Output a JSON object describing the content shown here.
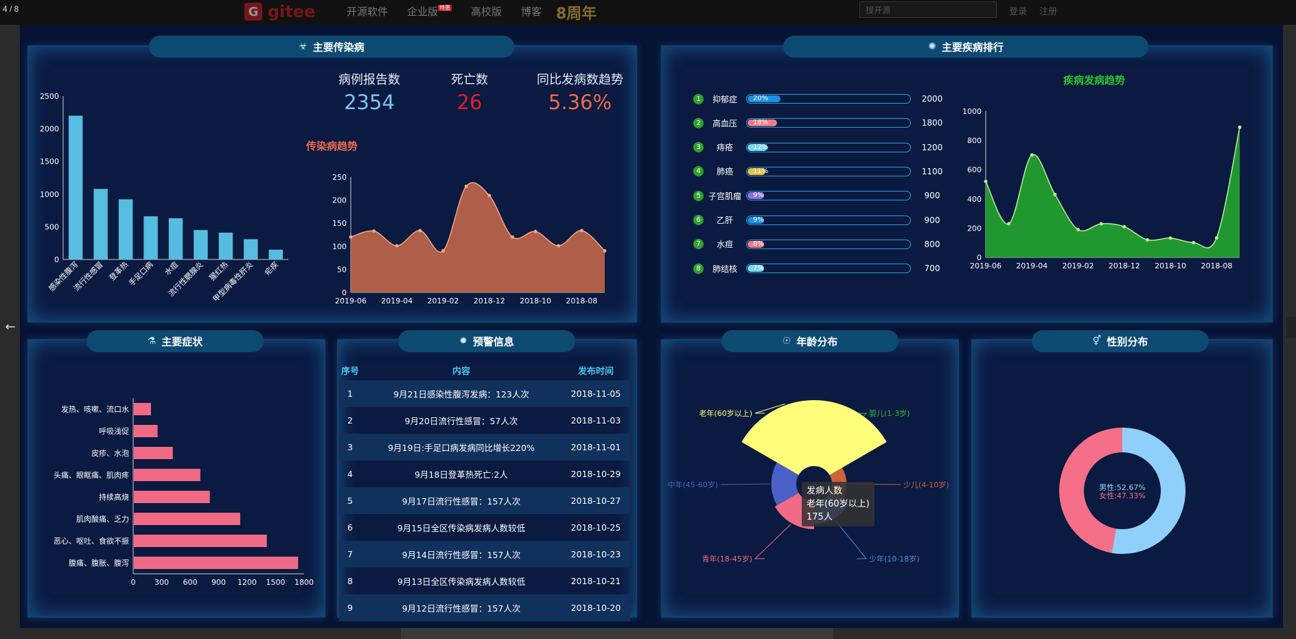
{
  "viewer": {
    "counter": "4 / 8",
    "prev_arrow": "←"
  },
  "browser_bg": {
    "brand": "gitee",
    "nav": [
      "开源软件",
      "企业版",
      "高校版",
      "博客"
    ],
    "badge": "特惠",
    "anniv": "8周年",
    "search_placeholder": "搜开源",
    "links": [
      "登录",
      "注册"
    ]
  },
  "infectious": {
    "title": "主要传染病",
    "stats": [
      {
        "label": "病例报告数",
        "value": "2354",
        "color": "#7cc4f6"
      },
      {
        "label": "死亡数",
        "value": "26",
        "color": "#e0202a"
      },
      {
        "label": "同比发病数趋势",
        "value": "5.36%",
        "color": "#ee6a4b"
      }
    ],
    "bar_chart": {
      "type": "bar",
      "categories": [
        "感染性腹泻",
        "流行性感冒",
        "登革热",
        "手足口病",
        "水痘",
        "流行性腮腺炎",
        "猩红热",
        "甲型病毒性肝炎",
        "疟疾"
      ],
      "values": [
        2200,
        1080,
        920,
        660,
        630,
        450,
        410,
        310,
        150
      ],
      "yticks": [
        "0",
        "500",
        "1000",
        "1500",
        "2000",
        "2500"
      ],
      "ylim": [
        0,
        2500
      ],
      "color": "#56bde0"
    },
    "trend_title": "传染病趋势",
    "trend_chart": {
      "type": "area",
      "values": [
        120,
        133,
        101,
        134,
        90,
        230,
        210,
        120,
        132,
        101,
        134,
        90
      ],
      "xticks": [
        "2019-06",
        "2019-04",
        "2019-02",
        "2018-12",
        "2018-10",
        "2018-08"
      ],
      "yticks": [
        "0",
        "50",
        "100",
        "150",
        "200",
        "250"
      ],
      "ylim": [
        0,
        250
      ],
      "color": "#c0664a"
    }
  },
  "ranking": {
    "title": "主要疾病排行",
    "items": [
      {
        "num": "1",
        "name": "抑郁症",
        "pct": "20%",
        "fill": 0.2,
        "color": "#1f8fe0",
        "value": "2000"
      },
      {
        "num": "2",
        "name": "高血压",
        "pct": "18%",
        "fill": 0.18,
        "color": "#f07a8a",
        "value": "1800"
      },
      {
        "num": "3",
        "name": "痔疮",
        "pct": "12%",
        "fill": 0.12,
        "color": "#7ad8f0",
        "value": "1200"
      },
      {
        "num": "4",
        "name": "肺癌",
        "pct": "11%",
        "fill": 0.11,
        "color": "#f0c040",
        "value": "1100"
      },
      {
        "num": "5",
        "name": "子宫肌瘤",
        "pct": "9%",
        "fill": 0.09,
        "color": "#8a70e0",
        "value": "900"
      },
      {
        "num": "6",
        "name": "乙肝",
        "pct": "9%",
        "fill": 0.09,
        "color": "#1f8fe0",
        "value": "900"
      },
      {
        "num": "7",
        "name": "水痘",
        "pct": "8%",
        "fill": 0.08,
        "color": "#f07a8a",
        "value": "800"
      },
      {
        "num": "8",
        "name": "肺结核",
        "pct": "7%",
        "fill": 0.07,
        "color": "#7ad8f0",
        "value": "700"
      }
    ],
    "trend_title": "疾病发病趋势",
    "trend_chart": {
      "type": "area",
      "values": [
        520,
        230,
        700,
        430,
        190,
        230,
        210,
        120,
        132,
        101,
        134,
        890
      ],
      "xticks": [
        "2019-06",
        "2019-04",
        "2019-02",
        "2018-12",
        "2018-10",
        "2018-08"
      ],
      "yticks": [
        "0",
        "200",
        "400",
        "600",
        "800",
        "1000"
      ],
      "ylim": [
        0,
        1000
      ],
      "color": "#24a52d"
    }
  },
  "symptoms": {
    "title": "主要症状",
    "chart": {
      "type": "bar",
      "categories": [
        "腹痛、腹胀、腹泻",
        "恶心、呕吐、食欲不振",
        "肌肉酸痛、乏力",
        "持续高烧",
        "头痛、眼眶痛、肌肉疼",
        "皮疹、水泡",
        "呼吸浅促",
        "发热、咳嗽、流口水"
      ],
      "values": [
        1730,
        1400,
        1120,
        800,
        700,
        410,
        250,
        180
      ],
      "xticks": [
        "0",
        "300",
        "600",
        "900",
        "1200",
        "1500",
        "1800"
      ],
      "xlim": [
        0,
        1800
      ],
      "color": "#f06a86"
    }
  },
  "warning": {
    "title": "预警信息",
    "headers": [
      "序号",
      "内容",
      "发布时间"
    ],
    "rows": [
      [
        "1",
        "9月21日感染性腹泻发病：123人次",
        "2018-11-05"
      ],
      [
        "2",
        "9月20日流行性感冒：57人次",
        "2018-11-03"
      ],
      [
        "3",
        "9月19日:手足口病发病同比增长220%",
        "2018-11-01"
      ],
      [
        "4",
        "9月18日登革热死亡:2人",
        "2018-10-29"
      ],
      [
        "5",
        "9月17日流行性感冒：157人次",
        "2018-10-27"
      ],
      [
        "6",
        "9月15日全区传染病发病人数较低",
        "2018-10-25"
      ],
      [
        "7",
        "9月14日流行性感冒：157人次",
        "2018-10-23"
      ],
      [
        "8",
        "9月13日全区传染病发病人数较低",
        "2018-10-21"
      ],
      [
        "9",
        "9月12日流行性感冒：157人次",
        "2018-10-20"
      ]
    ]
  },
  "age": {
    "title": "年龄分布",
    "chart": {
      "type": "pie",
      "labels": [
        "婴儿(1-3岁)",
        "少儿(4-10岁)",
        "少年(10-18岁)",
        "青年(18-45岁)",
        "中年(45-60岁)",
        "老年(60岁以上)"
      ],
      "values": [
        10,
        5,
        15,
        25,
        20,
        175
      ],
      "colors": [
        "#2fb844",
        "#d0623a",
        "#5a8ae0",
        "#f06a86",
        "#4a60c8",
        "#fffe7a"
      ]
    },
    "tooltip": {
      "title": "发病人数",
      "line": "老年(60岁以上)",
      "value": "175人"
    }
  },
  "gender": {
    "title": "性别分布",
    "chart": {
      "type": "pie",
      "labels": [
        "男性:52.67%",
        "女性:47.33%"
      ],
      "values": [
        52.67,
        47.33
      ],
      "colors": [
        "#8fd0fb",
        "#f56f88"
      ]
    }
  }
}
